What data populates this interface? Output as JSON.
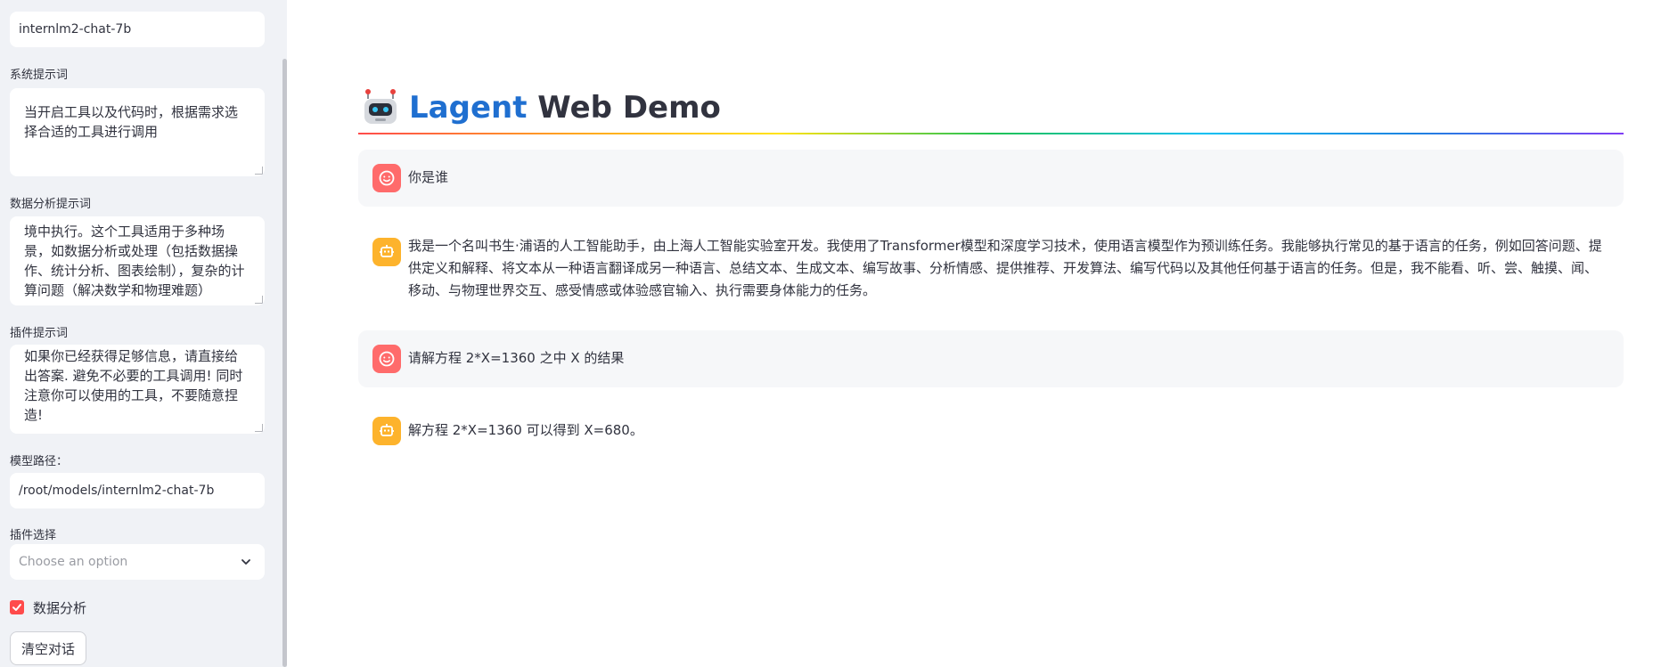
{
  "sidebar": {
    "model_name_value": "internlm2-chat-7b",
    "system_prompt_label": "系统提示词",
    "system_prompt_value": "当开启工具以及代码时，根据需求选择合适的工具进行调用",
    "data_analysis_prompt_label": "数据分析提示词",
    "data_analysis_prompt_value": "境中执行。这个工具适用于多种场景，如数据分析或处理（包括数据操作、统计分析、图表绘制），复杂的计算问题（解决数学和物理难题）",
    "plugin_prompt_label": "插件提示词",
    "plugin_prompt_value": "如果你已经获得足够信息，请直接给出答案. 避免不必要的工具调用! 同时注意你可以使用的工具，不要随意捏造!",
    "model_path_label": "模型路径：",
    "model_path_value": "/root/models/internlm2-chat-7b",
    "plugin_select_label": "插件选择",
    "plugin_select_placeholder": "Choose an option",
    "data_analysis_checkbox_label": "数据分析",
    "data_analysis_checked": true,
    "clear_button_label": "清空对话"
  },
  "header": {
    "title_accent": "Lagent",
    "title_rest": " Web Demo"
  },
  "messages": [
    {
      "role": "user",
      "text": "你是谁"
    },
    {
      "role": "assistant",
      "text": "我是一个名叫书生·浦语的人工智能助手，由上海人工智能实验室开发。我使用了Transformer模型和深度学习技术，使用语言模型作为预训练任务。我能够执行常见的基于语言的任务，例如回答问题、提供定义和解释、将文本从一种语言翻译成另一种语言、总结文本、生成文本、编写故事、分析情感、提供推荐、开发算法、编写代码以及其他任何基于语言的任务。但是，我不能看、听、尝、触摸、闻、移动、与物理世界交互、感受情感或体验感官输入、执行需要身体能力的任务。"
    },
    {
      "role": "user",
      "text": "请解方程 2*X=1360 之中 X 的结果"
    },
    {
      "role": "assistant",
      "text": "解方程 2*X=1360 可以得到 X=680。"
    }
  ],
  "icons": {
    "user_avatar": "smiley-face-icon",
    "assistant_avatar": "robot-icon",
    "title_logo": "robot-emoji-icon"
  },
  "colors": {
    "accent": "#1f6fd0",
    "user_avatar_bg": "#ff6b6b",
    "assistant_avatar_bg": "#fdb32c",
    "checkbox": "#ff4b4b"
  }
}
